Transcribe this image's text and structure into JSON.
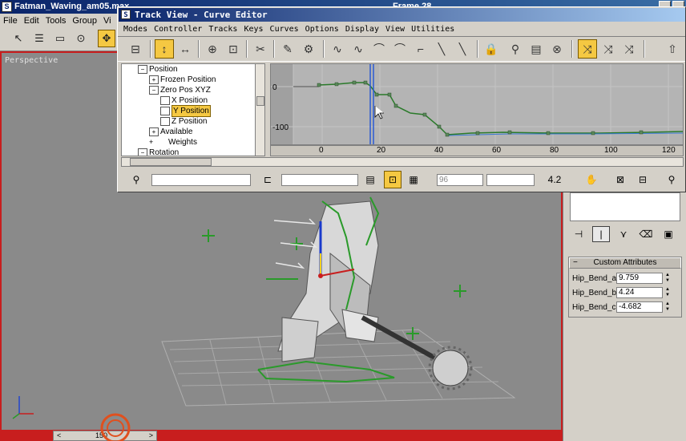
{
  "main_window": {
    "title": "Fatman_Waving_am05.max",
    "title_extra": "Frame 28",
    "menu": [
      "File",
      "Edit",
      "Tools",
      "Group",
      "Vi"
    ]
  },
  "viewport": {
    "label": "Perspective"
  },
  "track_view": {
    "title": "Track View - Curve Editor",
    "menu": [
      "Modes",
      "Controller",
      "Tracks",
      "Keys",
      "Curves",
      "Options",
      "Display",
      "View",
      "Utilities"
    ],
    "tree": [
      {
        "label": "Position",
        "indent": 0,
        "box": "-"
      },
      {
        "label": "Frozen Position",
        "indent": 1,
        "box": "+"
      },
      {
        "label": "Zero Pos XYZ",
        "indent": 1,
        "box": "-"
      },
      {
        "label": "X Position",
        "indent": 2,
        "box": ""
      },
      {
        "label": "Y Position",
        "indent": 2,
        "box": "",
        "selected": true
      },
      {
        "label": "Z Position",
        "indent": 2,
        "box": ""
      },
      {
        "label": "Available",
        "indent": 1,
        "box": "+"
      },
      {
        "label": "Weights",
        "indent": 1,
        "box": ""
      },
      {
        "label": "Rotation",
        "indent": 0,
        "box": "-"
      }
    ],
    "y_ticks": [
      "0",
      "-100"
    ],
    "ruler_ticks": [
      "0",
      "20",
      "40",
      "60",
      "80",
      "100",
      "120"
    ],
    "bottom": {
      "frame_field": "96",
      "value_field": "",
      "zoom_value": "4.2"
    }
  },
  "command_panel": {
    "rollout_title": "Custom Attributes",
    "attributes": [
      {
        "label": "Hip_Bend_a:",
        "value": "9.759"
      },
      {
        "label": "Hip_Bend_b:",
        "value": "4.24"
      },
      {
        "label": "Hip_Bend_c:",
        "value": "-4.682"
      }
    ]
  },
  "timeline": {
    "left": "<",
    "current": "150",
    "right": ">"
  },
  "colors": {
    "active": "#f5c842",
    "viewport_border": "#c81e1e",
    "curve": "#2a7a2a"
  }
}
